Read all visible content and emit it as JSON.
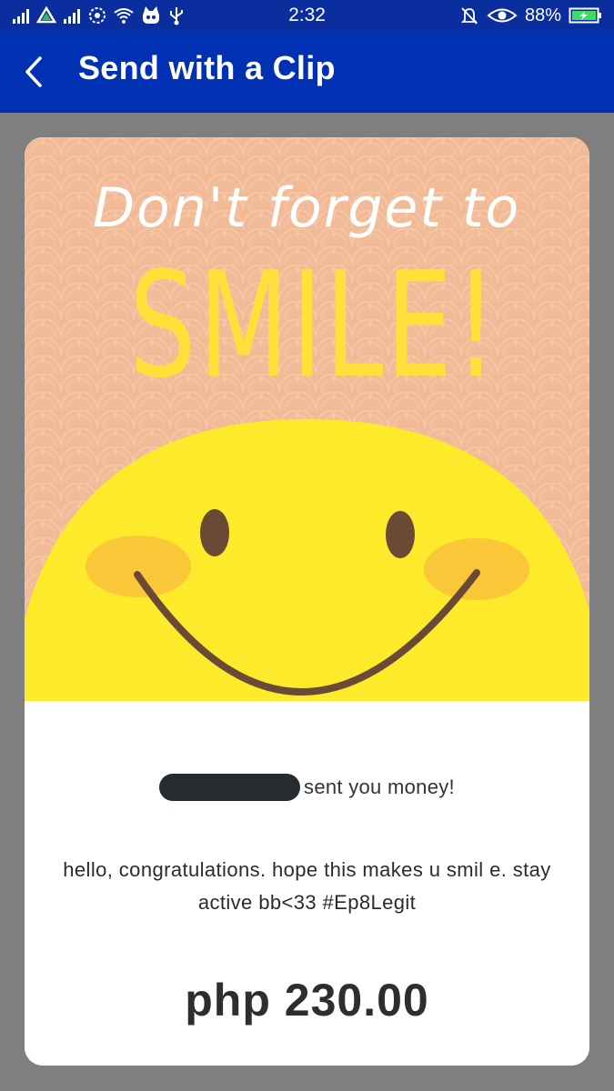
{
  "status_bar": {
    "time": "2:32",
    "battery_percent": "88%",
    "left_icons": [
      "signal-icon",
      "drive-icon",
      "signal-icon",
      "data-saver-icon",
      "wifi-icon",
      "bot-icon",
      "usb-icon"
    ],
    "right_icons": [
      "muted-bell-icon",
      "eye-icon",
      "battery-charging-icon"
    ]
  },
  "app_bar": {
    "back_icon": "chevron-left-icon",
    "title": "Send with a Clip"
  },
  "clip": {
    "headline_top": "Don't forget to",
    "headline_main": "SMILE!",
    "colors": {
      "background": "#f2bb98",
      "sun": "#fcea2b",
      "text_top": "#ffffff",
      "text_main": "#fde03a",
      "face": "#6b4a35",
      "cheeks": "#fac738"
    }
  },
  "card": {
    "sender_suffix": "sent you money!",
    "message": "hello, congratulations. hope this makes u smil e. stay active bb<33 #Ep8Legit",
    "amount": "php 230.00"
  },
  "colors": {
    "status_bar": "#0a2e9e",
    "app_bar": "#0031b3",
    "page_background": "#7f7f7f"
  }
}
